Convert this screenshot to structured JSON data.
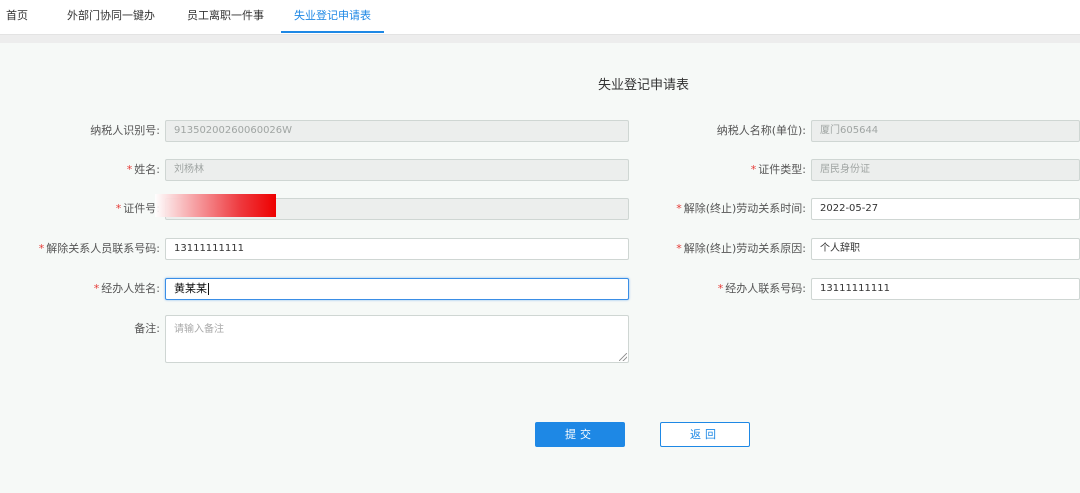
{
  "nav": {
    "tabs": [
      {
        "label": "首页"
      },
      {
        "label": "外部门协同一键办"
      },
      {
        "label": "员工离职一件事"
      },
      {
        "label": "失业登记申请表"
      }
    ],
    "active_tab": "失业登记申请表",
    "accent_color": "#1e88e5"
  },
  "form": {
    "title": "失业登记申请表",
    "fields": {
      "taxpayer_id": {
        "label": "纳税人识别号:",
        "value": "91350200260060026W",
        "required": false,
        "disabled": true
      },
      "taxpayer_name": {
        "label": "纳税人名称(单位):",
        "value": "厦门605644",
        "required": false,
        "disabled": true
      },
      "name": {
        "label": "姓名:",
        "value": "刘杨林",
        "required": true,
        "disabled": true
      },
      "id_type": {
        "label": "证件类型:",
        "value": "居民身份证",
        "required": true,
        "disabled": true
      },
      "id_number": {
        "label": "证件号:",
        "value": "",
        "required": true,
        "disabled": true
      },
      "termination_date": {
        "label": "解除(终止)劳动关系时间:",
        "value": "2022-05-27",
        "required": true,
        "disabled": false
      },
      "contact_phone": {
        "label": "解除关系人员联系号码:",
        "value": "13111111111",
        "required": true,
        "disabled": false
      },
      "termination_reason": {
        "label": "解除(终止)劳动关系原因:",
        "value": "个人辞职",
        "required": true,
        "disabled": false
      },
      "handler_name": {
        "label": "经办人姓名:",
        "value": "黄某某",
        "required": true,
        "disabled": false,
        "focused": true
      },
      "handler_phone": {
        "label": "经办人联系号码:",
        "value": "13111111111",
        "required": true,
        "disabled": false
      },
      "remarks": {
        "label": "备注:",
        "placeholder": "请输入备注",
        "value": ""
      }
    },
    "required_mark": "*",
    "required_color": "#e53935",
    "submit_label": "提交",
    "back_label": "返回"
  }
}
